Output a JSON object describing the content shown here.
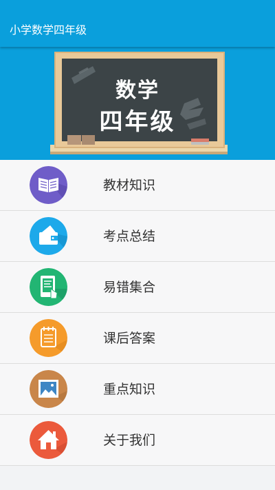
{
  "appbar": {
    "title": "小学数学四年级"
  },
  "banner": {
    "line1": "数学",
    "line2": "四年级"
  },
  "menu": {
    "items": [
      {
        "label": "教材知识",
        "icon": "book-icon",
        "color": "#6f5dc8"
      },
      {
        "label": "考点总结",
        "icon": "wallet-icon",
        "color": "#1da9ea"
      },
      {
        "label": "易错集合",
        "icon": "tablet-touch-icon",
        "color": "#22b573"
      },
      {
        "label": "课后答案",
        "icon": "notepad-icon",
        "color": "#f59b2b"
      },
      {
        "label": "重点知识",
        "icon": "picture-icon",
        "color": "#c9864a"
      },
      {
        "label": "关于我们",
        "icon": "home-icon",
        "color": "#eb5a3c"
      }
    ]
  }
}
